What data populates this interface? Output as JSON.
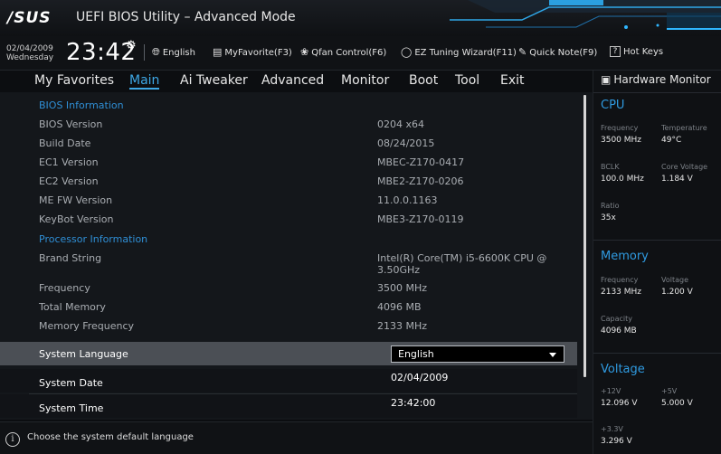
{
  "title_bar": {
    "logo": "/SUS",
    "title": "UEFI BIOS Utility – Advanced Mode"
  },
  "toolbar": {
    "date": "02/04/2009",
    "weekday": "Wednesday",
    "time": "23:42",
    "items": [
      {
        "label": "English",
        "icon": "globe-icon"
      },
      {
        "label": "MyFavorite(F3)",
        "icon": "favorite-icon"
      },
      {
        "label": "Qfan Control(F6)",
        "icon": "fan-icon"
      },
      {
        "label": "EZ Tuning Wizard(F11)",
        "icon": "bulb-icon"
      },
      {
        "label": "Quick Note(F9)",
        "icon": "note-icon"
      },
      {
        "label": "Hot Keys",
        "icon": "hotkeys-icon",
        "box_char": "?"
      }
    ]
  },
  "menu": {
    "items": [
      "My Favorites",
      "Main",
      "Ai Tweaker",
      "Advanced",
      "Monitor",
      "Boot",
      "Tool",
      "Exit"
    ],
    "active": "Main"
  },
  "main": {
    "bios_section": "BIOS Information",
    "bios_rows": [
      {
        "label": "BIOS Version",
        "value": "0204 x64"
      },
      {
        "label": "Build Date",
        "value": "08/24/2015"
      },
      {
        "label": "EC1 Version",
        "value": "MBEC-Z170-0417"
      },
      {
        "label": "EC2 Version",
        "value": "MBE2-Z170-0206"
      },
      {
        "label": "ME FW Version",
        "value": "11.0.0.1163"
      },
      {
        "label": "KeyBot Version",
        "value": "MBE3-Z170-0119"
      }
    ],
    "processor_section": "Processor Information",
    "processor_rows": [
      {
        "label": "Brand String",
        "value": "Intel(R) Core(TM) i5-6600K CPU @ 3.50GHz"
      },
      {
        "label": "Frequency",
        "value": "3500 MHz"
      },
      {
        "label": "Total Memory",
        "value": "4096 MB"
      },
      {
        "label": "Memory Frequency",
        "value": "2133 MHz"
      }
    ],
    "system_language": {
      "label": "System Language",
      "value": "English"
    },
    "system_date": {
      "label": "System Date",
      "value": "02/04/2009"
    },
    "system_time": {
      "label": "System Time",
      "value": "23:42:00"
    }
  },
  "hardware_monitor": {
    "title": "Hardware Monitor",
    "cpu": {
      "title": "CPU",
      "frequency_label": "Frequency",
      "frequency": "3500 MHz",
      "temperature_label": "Temperature",
      "temperature": "49°C",
      "bclk_label": "BCLK",
      "bclk": "100.0 MHz",
      "core_voltage_label": "Core Voltage",
      "core_voltage": "1.184 V",
      "ratio_label": "Ratio",
      "ratio": "35x"
    },
    "memory": {
      "title": "Memory",
      "frequency_label": "Frequency",
      "frequency": "2133 MHz",
      "voltage_label": "Voltage",
      "voltage": "1.200 V",
      "capacity_label": "Capacity",
      "capacity": "4096 MB"
    },
    "voltage": {
      "title": "Voltage",
      "v12_label": "+12V",
      "v12": "12.096 V",
      "v5_label": "+5V",
      "v5": "5.000 V",
      "v33_label": "+3.3V",
      "v33": "3.296 V"
    }
  },
  "status_bar": {
    "help_text": "Choose the system default language"
  },
  "colors": {
    "accent": "#2f8fd6",
    "selected_row": "#4b4f55",
    "background": "#14171b"
  }
}
